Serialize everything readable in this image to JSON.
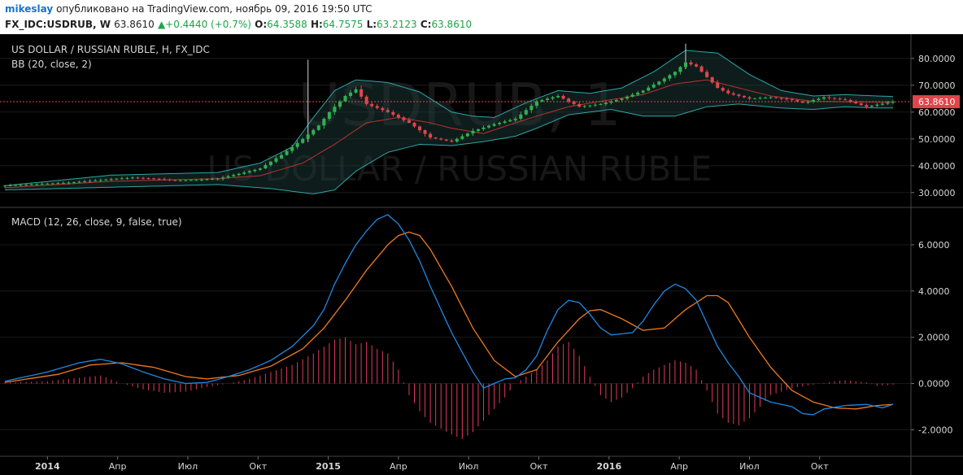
{
  "header": {
    "author": "mikeslay",
    "published_text": "опубликовано на TradingView.com, ноябрь 09, 2016 19:50 UTC",
    "symbol": "FX_IDC:USDRUB, W",
    "last": "63.8610",
    "change_arrow": "▲",
    "change": "+0.4440 (+0.7%)",
    "o_label": "O:",
    "o": "64.3588",
    "h_label": "H:",
    "h": "64.7575",
    "l_label": "L:",
    "l": "63.2123",
    "c_label": "C:",
    "c": "63.8610"
  },
  "colors": {
    "up": "#2fb150",
    "down": "#e0454a",
    "bb_band": "#2ea6a6",
    "bb_mid": "#b8342f",
    "macd": "#1e88e5",
    "signal": "#f07a1f",
    "hist": "#e23a5b",
    "last_price": "#e0454a"
  },
  "chart_data": [
    {
      "type": "candlestick",
      "title": "US DOLLAR / RUSSIAN RUBLE, H, FX_IDC",
      "watermark_symbol": "USDRUB, 1",
      "watermark_name": "US DOLLAR / RUSSIAN RUBLE",
      "indicator_label": "BB (20, close, 2)",
      "last_price_label": "63.8610",
      "ylim": [
        26,
        86
      ],
      "y_ticks": [
        30,
        40,
        50,
        60,
        70,
        80
      ],
      "y_tick_labels": [
        "30.0000",
        "40.0000",
        "50.0000",
        "60.0000",
        "70.0000",
        "80.0000"
      ],
      "x_tick_labels": [
        "2014",
        "Апр",
        "Июл",
        "Окт",
        "2015",
        "Апр",
        "Июл",
        "Окт",
        "2016",
        "Апр",
        "Июл",
        "Окт"
      ],
      "close_anchors": [
        [
          0,
          32.6
        ],
        [
          12,
          33.7
        ],
        [
          20,
          35.0
        ],
        [
          24,
          35.6
        ],
        [
          28,
          35.2
        ],
        [
          32,
          34.5
        ],
        [
          36,
          34.7
        ],
        [
          40,
          35.2
        ],
        [
          44,
          37.0
        ],
        [
          48,
          39.0
        ],
        [
          52,
          44.0
        ],
        [
          56,
          50.0
        ],
        [
          59,
          55.0
        ],
        [
          61,
          60.0
        ],
        [
          64,
          66.0
        ],
        [
          66,
          68.5
        ],
        [
          68,
          63.0
        ],
        [
          72,
          60.0
        ],
        [
          76,
          56.0
        ],
        [
          80,
          50.5
        ],
        [
          84,
          49.0
        ],
        [
          88,
          53.0
        ],
        [
          92,
          55.5
        ],
        [
          96,
          57.5
        ],
        [
          100,
          64.0
        ],
        [
          104,
          66.0
        ],
        [
          108,
          62.0
        ],
        [
          112,
          63.0
        ],
        [
          116,
          65.0
        ],
        [
          120,
          68.0
        ],
        [
          124,
          72.5
        ],
        [
          126,
          75.0
        ],
        [
          128,
          78.5
        ],
        [
          130,
          77.0
        ],
        [
          132,
          73.0
        ],
        [
          134,
          69.0
        ],
        [
          136,
          67.0
        ],
        [
          140,
          65.0
        ],
        [
          144,
          65.5
        ],
        [
          148,
          64.5
        ],
        [
          150,
          63.5
        ],
        [
          154,
          65.5
        ],
        [
          158,
          64.5
        ],
        [
          162,
          62.0
        ],
        [
          167,
          63.9
        ]
      ],
      "upper_band_anchors": [
        [
          0,
          32.6
        ],
        [
          20,
          36.5
        ],
        [
          40,
          37.5
        ],
        [
          48,
          41.0
        ],
        [
          54,
          47.0
        ],
        [
          58,
          58.0
        ],
        [
          62,
          68.0
        ],
        [
          66,
          72.0
        ],
        [
          72,
          71.0
        ],
        [
          78,
          67.5
        ],
        [
          84,
          60.0
        ],
        [
          88,
          58.5
        ],
        [
          92,
          58.0
        ],
        [
          98,
          63.5
        ],
        [
          104,
          68.0
        ],
        [
          110,
          67.0
        ],
        [
          116,
          69.0
        ],
        [
          122,
          75.0
        ],
        [
          128,
          83.0
        ],
        [
          134,
          82.0
        ],
        [
          140,
          74.0
        ],
        [
          146,
          68.0
        ],
        [
          152,
          66.0
        ],
        [
          158,
          66.5
        ],
        [
          164,
          66.0
        ],
        [
          167,
          65.8
        ]
      ],
      "lower_band_anchors": [
        [
          0,
          31.0
        ],
        [
          20,
          32.0
        ],
        [
          40,
          33.0
        ],
        [
          50,
          31.5
        ],
        [
          58,
          29.5
        ],
        [
          62,
          31.0
        ],
        [
          66,
          38.0
        ],
        [
          72,
          45.0
        ],
        [
          78,
          48.0
        ],
        [
          84,
          47.5
        ],
        [
          90,
          49.0
        ],
        [
          96,
          51.0
        ],
        [
          100,
          54.0
        ],
        [
          106,
          59.0
        ],
        [
          114,
          61.0
        ],
        [
          120,
          58.5
        ],
        [
          126,
          58.5
        ],
        [
          132,
          62.0
        ],
        [
          138,
          63.0
        ],
        [
          146,
          61.5
        ],
        [
          152,
          61.0
        ],
        [
          158,
          62.0
        ],
        [
          164,
          61.5
        ],
        [
          167,
          61.5
        ]
      ],
      "middle_band_anchors": [
        [
          0,
          31.8
        ],
        [
          20,
          34.2
        ],
        [
          40,
          35.2
        ],
        [
          48,
          36.3
        ],
        [
          56,
          41.0
        ],
        [
          62,
          48.0
        ],
        [
          68,
          56.0
        ],
        [
          74,
          58.0
        ],
        [
          80,
          56.0
        ],
        [
          84,
          54.0
        ],
        [
          90,
          52.0
        ],
        [
          96,
          56.0
        ],
        [
          100,
          58.5
        ],
        [
          106,
          62.0
        ],
        [
          112,
          64.0
        ],
        [
          120,
          66.5
        ],
        [
          126,
          70.5
        ],
        [
          132,
          72.0
        ],
        [
          138,
          69.0
        ],
        [
          144,
          66.0
        ],
        [
          152,
          64.0
        ],
        [
          160,
          63.8
        ],
        [
          167,
          63.7
        ]
      ]
    },
    {
      "type": "line",
      "title": "MACD (12, 26, close, 9, false, true)",
      "ylim": [
        -2.9,
        7.3
      ],
      "y_ticks": [
        -2,
        0,
        2,
        4,
        6
      ],
      "y_tick_labels": [
        "-2.0000",
        "0.0000",
        "2.0000",
        "4.0000",
        "6.0000"
      ],
      "series": [
        {
          "name": "MACD",
          "anchors": [
            [
              0,
              0.1
            ],
            [
              8,
              0.5
            ],
            [
              14,
              0.9
            ],
            [
              18,
              1.05
            ],
            [
              22,
              0.85
            ],
            [
              26,
              0.5
            ],
            [
              30,
              0.2
            ],
            [
              34,
              0.0
            ],
            [
              38,
              0.05
            ],
            [
              42,
              0.3
            ],
            [
              46,
              0.6
            ],
            [
              50,
              1.0
            ],
            [
              54,
              1.6
            ],
            [
              58,
              2.5
            ],
            [
              60,
              3.2
            ],
            [
              62,
              4.3
            ],
            [
              64,
              5.2
            ],
            [
              66,
              6.0
            ],
            [
              68,
              6.6
            ],
            [
              70,
              7.1
            ],
            [
              72,
              7.3
            ],
            [
              74,
              6.9
            ],
            [
              76,
              6.2
            ],
            [
              78,
              5.3
            ],
            [
              80,
              4.2
            ],
            [
              84,
              2.2
            ],
            [
              88,
              0.5
            ],
            [
              90,
              -0.2
            ],
            [
              92,
              0.0
            ],
            [
              94,
              0.2
            ],
            [
              96,
              0.25
            ],
            [
              98,
              0.6
            ],
            [
              100,
              1.2
            ],
            [
              102,
              2.3
            ],
            [
              104,
              3.2
            ],
            [
              106,
              3.6
            ],
            [
              108,
              3.5
            ],
            [
              110,
              3.0
            ],
            [
              112,
              2.4
            ],
            [
              114,
              2.1
            ],
            [
              118,
              2.2
            ],
            [
              120,
              2.7
            ],
            [
              122,
              3.4
            ],
            [
              124,
              4.0
            ],
            [
              126,
              4.3
            ],
            [
              128,
              4.1
            ],
            [
              130,
              3.6
            ],
            [
              132,
              2.6
            ],
            [
              134,
              1.6
            ],
            [
              136,
              0.9
            ],
            [
              138,
              0.3
            ],
            [
              140,
              -0.4
            ],
            [
              144,
              -0.8
            ],
            [
              148,
              -1.0
            ],
            [
              150,
              -1.3
            ],
            [
              152,
              -1.35
            ],
            [
              154,
              -1.1
            ],
            [
              158,
              -0.95
            ],
            [
              162,
              -0.9
            ],
            [
              165,
              -1.05
            ],
            [
              167,
              -0.9
            ]
          ]
        },
        {
          "name": "Signal",
          "anchors": [
            [
              0,
              0.05
            ],
            [
              10,
              0.4
            ],
            [
              16,
              0.8
            ],
            [
              22,
              0.9
            ],
            [
              28,
              0.7
            ],
            [
              34,
              0.3
            ],
            [
              38,
              0.2
            ],
            [
              44,
              0.35
            ],
            [
              50,
              0.75
            ],
            [
              56,
              1.5
            ],
            [
              60,
              2.4
            ],
            [
              64,
              3.6
            ],
            [
              68,
              4.9
            ],
            [
              72,
              6.0
            ],
            [
              74,
              6.4
            ],
            [
              76,
              6.55
            ],
            [
              78,
              6.4
            ],
            [
              80,
              5.8
            ],
            [
              84,
              4.2
            ],
            [
              88,
              2.4
            ],
            [
              92,
              1.0
            ],
            [
              96,
              0.3
            ],
            [
              100,
              0.6
            ],
            [
              104,
              1.8
            ],
            [
              108,
              2.8
            ],
            [
              110,
              3.15
            ],
            [
              112,
              3.2
            ],
            [
              116,
              2.8
            ],
            [
              120,
              2.3
            ],
            [
              124,
              2.4
            ],
            [
              128,
              3.2
            ],
            [
              132,
              3.8
            ],
            [
              134,
              3.8
            ],
            [
              136,
              3.5
            ],
            [
              140,
              2.0
            ],
            [
              144,
              0.7
            ],
            [
              148,
              -0.3
            ],
            [
              152,
              -0.8
            ],
            [
              156,
              -1.05
            ],
            [
              160,
              -1.1
            ],
            [
              164,
              -0.95
            ],
            [
              167,
              -0.9
            ]
          ]
        },
        {
          "name": "Histogram",
          "anchors": [
            [
              0,
              0.05
            ],
            [
              8,
              0.1
            ],
            [
              14,
              0.25
            ],
            [
              18,
              0.35
            ],
            [
              22,
              0.0
            ],
            [
              26,
              -0.25
            ],
            [
              30,
              -0.4
            ],
            [
              34,
              -0.35
            ],
            [
              38,
              -0.15
            ],
            [
              42,
              0.0
            ],
            [
              46,
              0.2
            ],
            [
              50,
              0.5
            ],
            [
              54,
              0.8
            ],
            [
              58,
              1.3
            ],
            [
              62,
              1.9
            ],
            [
              64,
              2.0
            ],
            [
              66,
              1.7
            ],
            [
              68,
              1.8
            ],
            [
              70,
              1.5
            ],
            [
              72,
              1.3
            ],
            [
              74,
              0.6
            ],
            [
              76,
              -0.5
            ],
            [
              78,
              -1.2
            ],
            [
              80,
              -1.7
            ],
            [
              84,
              -2.2
            ],
            [
              86,
              -2.4
            ],
            [
              88,
              -2.1
            ],
            [
              90,
              -1.6
            ],
            [
              92,
              -1.1
            ],
            [
              94,
              -0.6
            ],
            [
              96,
              0.0
            ],
            [
              98,
              0.3
            ],
            [
              100,
              0.6
            ],
            [
              102,
              1.0
            ],
            [
              104,
              1.6
            ],
            [
              106,
              1.8
            ],
            [
              108,
              1.2
            ],
            [
              110,
              0.3
            ],
            [
              112,
              -0.5
            ],
            [
              114,
              -0.8
            ],
            [
              116,
              -0.6
            ],
            [
              118,
              -0.2
            ],
            [
              120,
              0.3
            ],
            [
              122,
              0.6
            ],
            [
              124,
              0.8
            ],
            [
              126,
              1.0
            ],
            [
              128,
              0.9
            ],
            [
              130,
              0.6
            ],
            [
              132,
              -0.3
            ],
            [
              134,
              -1.3
            ],
            [
              136,
              -1.7
            ],
            [
              138,
              -1.8
            ],
            [
              140,
              -1.5
            ],
            [
              142,
              -1.0
            ],
            [
              144,
              -0.5
            ],
            [
              148,
              -0.2
            ],
            [
              152,
              -0.05
            ],
            [
              156,
              0.1
            ],
            [
              158,
              0.15
            ],
            [
              162,
              0.05
            ],
            [
              164,
              -0.1
            ],
            [
              167,
              -0.05
            ]
          ]
        }
      ]
    }
  ]
}
